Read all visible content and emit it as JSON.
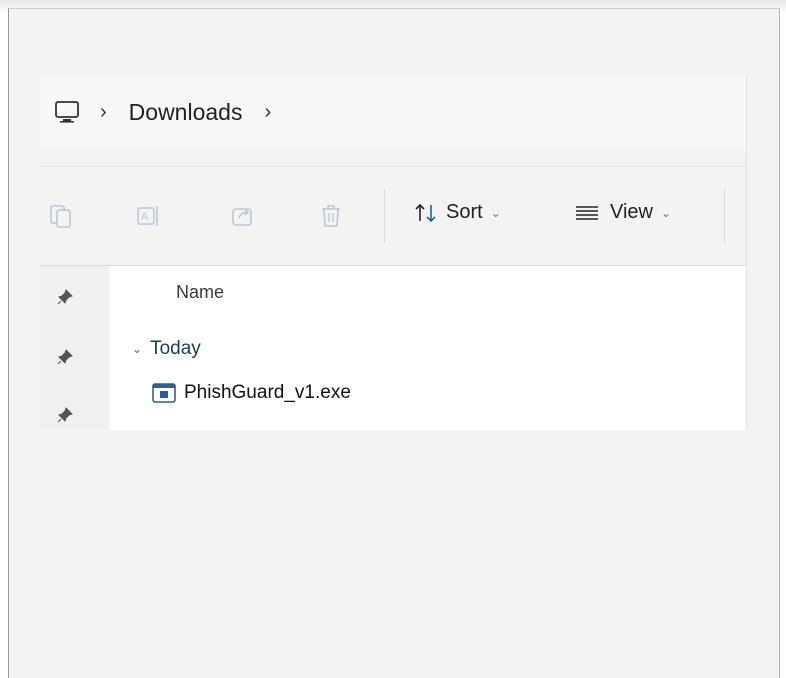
{
  "breadcrumb": {
    "root_icon": "computer-icon",
    "separator": "›",
    "items": [
      {
        "label": "Downloads"
      }
    ]
  },
  "toolbar": {
    "icons": [
      "copy-icon",
      "rename-icon",
      "share-icon",
      "delete-icon"
    ],
    "sort_label": "Sort",
    "view_label": "View"
  },
  "file_list": {
    "column_name": "Name",
    "groups": [
      {
        "label": "Today",
        "files": [
          {
            "name": "PhishGuard_v1.exe",
            "icon": "exe-file-icon"
          }
        ]
      }
    ]
  },
  "quick_access": {
    "pin_icons": [
      "pin-icon",
      "pin-icon",
      "pin-icon"
    ]
  },
  "colors": {
    "window_background": "#f3f3f3",
    "list_background": "#ffffff",
    "accent": "#1a5fb4"
  }
}
